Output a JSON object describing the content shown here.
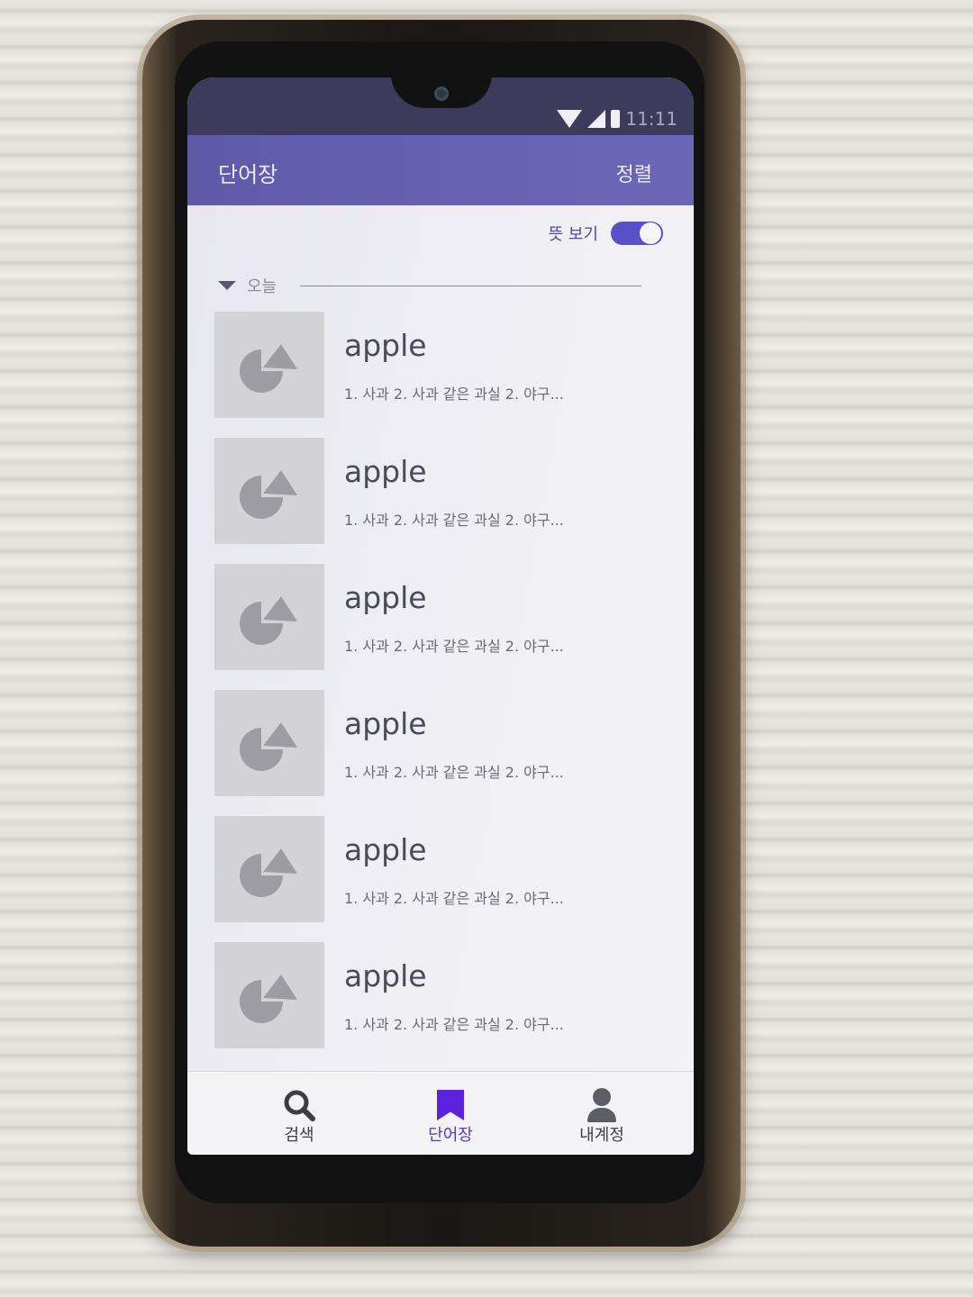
{
  "status": {
    "time": "11:11"
  },
  "appbar": {
    "title": "단어장",
    "sort_label": "정렬"
  },
  "toggle": {
    "label": "뜻 보기",
    "on": true
  },
  "section": {
    "label": "오늘"
  },
  "items": [
    {
      "word": "apple",
      "definition": "1. 사과  2. 사과 같은 과실  2. 야구..."
    },
    {
      "word": "apple",
      "definition": "1. 사과  2. 사과 같은 과실  2. 야구..."
    },
    {
      "word": "apple",
      "definition": "1. 사과  2. 사과 같은 과실  2. 야구..."
    },
    {
      "word": "apple",
      "definition": "1. 사과  2. 사과 같은 과실  2. 야구..."
    },
    {
      "word": "apple",
      "definition": "1. 사과  2. 사과 같은 과실  2. 야구..."
    },
    {
      "word": "apple",
      "definition": "1. 사과  2. 사과 같은 과실  2. 야구..."
    }
  ],
  "nav": {
    "search": "검색",
    "wordbook": "단어장",
    "account": "내계정",
    "active": "wordbook"
  },
  "colors": {
    "accent": "#5a22dc",
    "appbar": "#6762b3"
  }
}
